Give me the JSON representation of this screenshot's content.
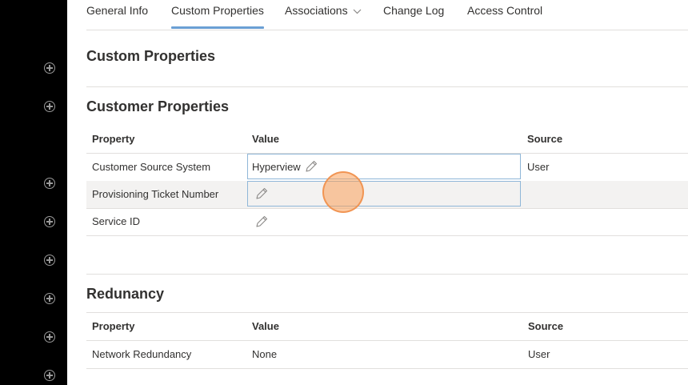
{
  "tabs": [
    {
      "label": "General Info"
    },
    {
      "label": "Custom Properties",
      "active": true
    },
    {
      "label": "Associations"
    },
    {
      "label": "Change Log"
    },
    {
      "label": "Access Control"
    }
  ],
  "page_title": "Custom Properties",
  "customer_section": {
    "title": "Customer Properties",
    "headers": {
      "property": "Property",
      "value": "Value",
      "source": "Source"
    },
    "rows": [
      {
        "property": "Customer Source System",
        "value": "Hyperview",
        "source": "User"
      },
      {
        "property": "Provisioning Ticket Number",
        "value": "",
        "source": ""
      },
      {
        "property": "Service ID",
        "value": "",
        "source": ""
      }
    ]
  },
  "redundancy_section": {
    "title": "Redunancy",
    "headers": {
      "property": "Property",
      "value": "Value",
      "source": "Source"
    },
    "rows": [
      {
        "property": "Network Redundancy",
        "value": "None",
        "source": "User"
      }
    ]
  },
  "icons": {
    "sidebar": [
      "add-circle-icon",
      "add-circle-icon",
      "add-circle-icon",
      "add-circle-icon",
      "add-circle-icon",
      "add-circle-icon",
      "add-circle-icon",
      "add-circle-icon"
    ],
    "edit": "pencil-icon",
    "dropdown": "chevron-down-icon"
  },
  "colors": {
    "sidebar_bg": "#000000",
    "active_tab_underline": "#6a9fd4",
    "edit_box_border": "#8fb6d8",
    "highlight_row": "#f3f2f1",
    "click_indicator": "#f5a05a"
  }
}
